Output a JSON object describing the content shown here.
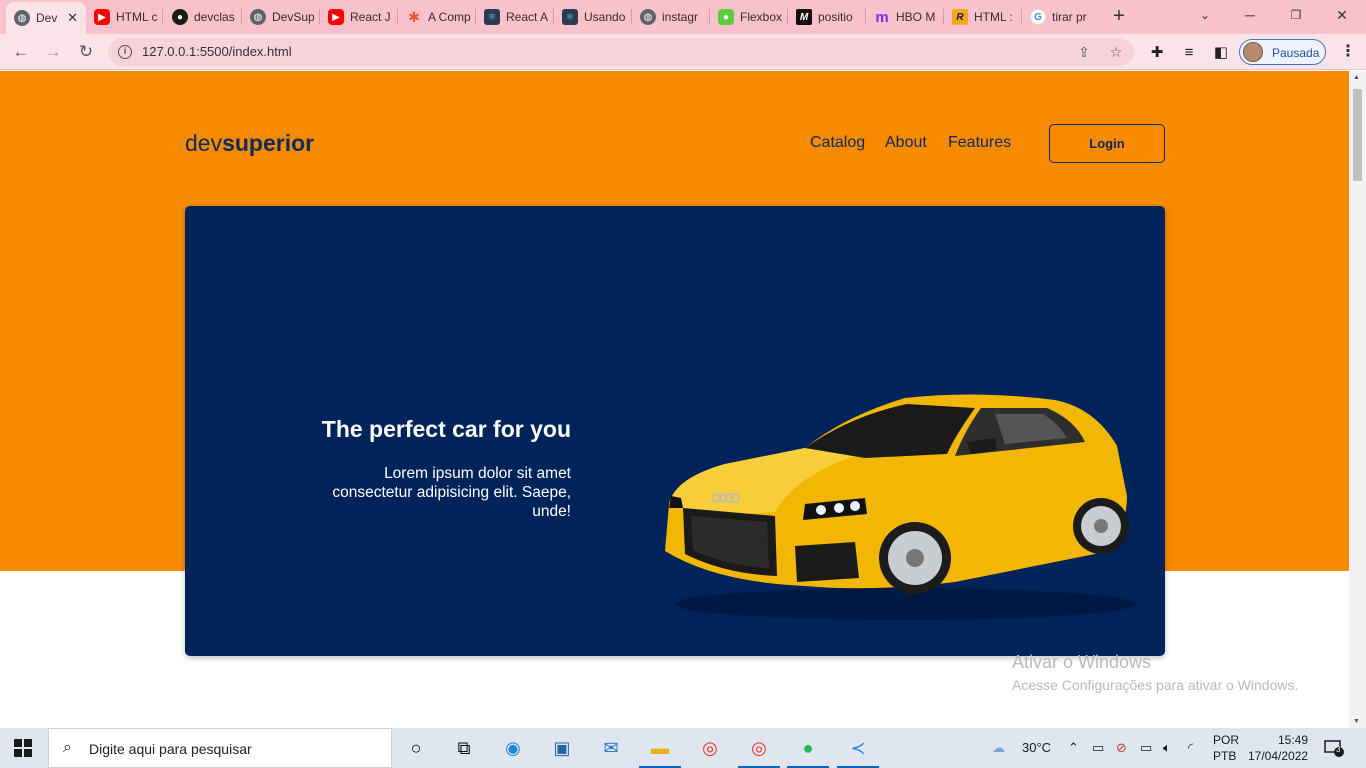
{
  "browser": {
    "tabs": [
      {
        "label": "Dev",
        "icon": "globe-icon",
        "color": "#5f6368",
        "active": true
      },
      {
        "label": "HTML c",
        "icon": "youtube-icon",
        "color": "#ff0000"
      },
      {
        "label": "devclas",
        "icon": "github-icon",
        "color": "#1a1a1a"
      },
      {
        "label": "DevSup",
        "icon": "globe-icon",
        "color": "#5f6368"
      },
      {
        "label": "React J",
        "icon": "youtube-icon",
        "color": "#ff0000"
      },
      {
        "label": "A Comp",
        "icon": "asterisk-icon",
        "color": "#e8553d"
      },
      {
        "label": "React A",
        "icon": "react-icon",
        "color": "#2b3a4e"
      },
      {
        "label": "Usando",
        "icon": "react-icon",
        "color": "#2b3a4e"
      },
      {
        "label": "instagr",
        "icon": "globe-icon",
        "color": "#5f6368"
      },
      {
        "label": "Flexbox",
        "icon": "frog-icon",
        "color": "#5ccd3a"
      },
      {
        "label": "positio",
        "icon": "medium-icon",
        "color": "#111111"
      },
      {
        "label": "HBO M",
        "icon": "hbo-m-icon",
        "color": "#7b2ff2"
      },
      {
        "label": "HTML :",
        "icon": "r-icon",
        "color": "#f5a623"
      },
      {
        "label": "tirar pr",
        "icon": "google-icon",
        "color": "#4285f4"
      }
    ],
    "url": "127.0.0.1:5500/index.html",
    "profile_label": "Pausada"
  },
  "page": {
    "brand_light": "dev",
    "brand_bold": "superior",
    "nav": [
      "Catalog",
      "About",
      "Features"
    ],
    "login_label": "Login",
    "hero_title": "The perfect car for you",
    "hero_text": "Lorem ipsum dolor sit amet consectetur adipisicing elit. Saepe, unde!",
    "colors": {
      "band": "#f68a00",
      "card": "#00235a",
      "brand_text": "#0f2a5c",
      "car": "#f2b705"
    }
  },
  "watermark": {
    "title": "Ativar o Windows",
    "subtitle": "Acesse Configurações para ativar o Windows."
  },
  "taskbar": {
    "search_placeholder": "Digite aqui para pesquisar",
    "weather": "30°C",
    "lang_top": "POR",
    "lang_bottom": "PTB",
    "time": "15:49",
    "date": "17/04/2022",
    "notification_count": "3"
  }
}
